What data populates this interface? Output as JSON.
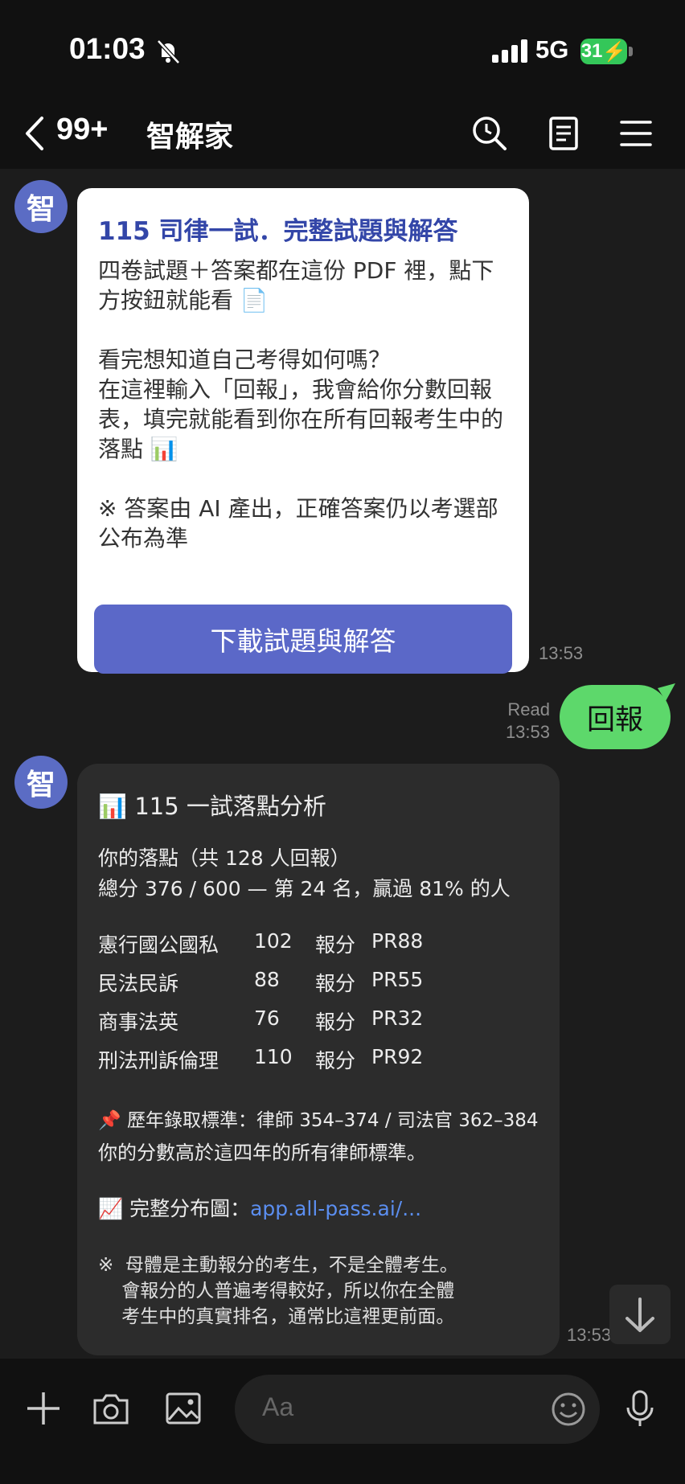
{
  "status": {
    "time": "01:03",
    "network": "5G",
    "battery": "31"
  },
  "nav": {
    "unread_count": "99+",
    "title": "智解家"
  },
  "messages": {
    "card1": {
      "title": "115 司律一試．完整試題與解答",
      "body": "四卷試題＋答案都在這份 PDF 裡，點下方按鈕就能看 📄\n\n看完想知道自己考得如何嗎？\n在這裡輸入「回報」，我會給你分數回報表，填完就能看到你在所有回報考生中的落點 📊\n\n※ 答案由 AI 產出，正確答案仍以考選部公布為準",
      "button": "下載試題與解答",
      "time": "13:53"
    },
    "reply": {
      "text": "回報",
      "read": "Read",
      "time": "13:53"
    },
    "card2": {
      "title": "📊 115 一試落點分析",
      "line1": "你的落點（共 128 人回報）",
      "line2": "總分 376 / 600 — 第 24 名，贏過 81% 的人",
      "rows": [
        {
          "subject": "憲行國公國私",
          "score": "102",
          "label": "報分",
          "pr": "PR88"
        },
        {
          "subject": "民法民訴",
          "score": "88",
          "label": "報分",
          "pr": "PR55"
        },
        {
          "subject": "商事法英",
          "score": "76",
          "label": "報分",
          "pr": "PR32"
        },
        {
          "subject": "刑法刑訴倫理",
          "score": "110",
          "label": "報分",
          "pr": "PR92"
        }
      ],
      "standard": "📌 歷年錄取標準：律師 354–374 / 司法官 362–384",
      "standard_note": "你的分數高於這四年的所有律師標準。",
      "dist_label": "📈 完整分布圖：",
      "dist_link": "app.all-pass.ai/...",
      "note": "※  母體是主動報分的考生，不是全體考生。\n    會報分的人普遍考得較好，所以你在全體\n    考生中的真實排名，通常比這裡更前面。",
      "time": "13:53"
    }
  },
  "input": {
    "placeholder": "Aa"
  },
  "colors": {
    "accent": "#5b68c8",
    "bubble": "#5dd86b",
    "link": "#5b8ef0"
  }
}
